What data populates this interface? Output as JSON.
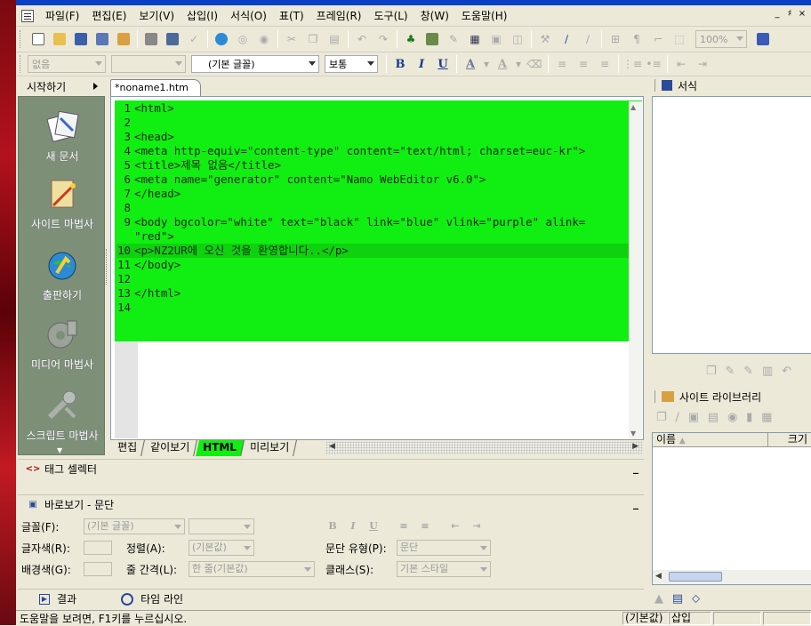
{
  "menu": {
    "items": [
      "파일(F)",
      "편집(E)",
      "보기(V)",
      "삽입(I)",
      "서식(O)",
      "표(T)",
      "프레임(R)",
      "도구(L)",
      "창(W)",
      "도움말(H)"
    ],
    "window_controls": [
      "_",
      "♯",
      "×"
    ]
  },
  "toolbar": {
    "zoom": "100%",
    "style_combo": "없음",
    "font_combo": "(기본 글꼴)",
    "size_combo": "보통",
    "bold": "B",
    "italic": "I",
    "underline": "U",
    "font_color": "A",
    "highlight": "A"
  },
  "left_panel": {
    "header": "시작하기",
    "items": [
      {
        "label": "새 문서",
        "icon": "new-document-icon"
      },
      {
        "label": "사이트 마법사",
        "icon": "site-wizard-icon"
      },
      {
        "label": "출판하기",
        "icon": "publish-globe-icon"
      },
      {
        "label": "미디어 마법사",
        "icon": "media-wizard-icon"
      },
      {
        "label": "스크립트 마법사",
        "icon": "script-wizard-icon"
      }
    ]
  },
  "document": {
    "tab": "*noname1.htm",
    "code_lines": [
      {
        "n": "1",
        "text": "<html>"
      },
      {
        "n": "2",
        "text": ""
      },
      {
        "n": "3",
        "text": "<head>"
      },
      {
        "n": "4",
        "text": "<meta http-equiv=\"content-type\" content=\"text/html; charset=euc-kr\">"
      },
      {
        "n": "5",
        "text": "<title>제목 없음</title>"
      },
      {
        "n": "6",
        "text": "<meta name=\"generator\" content=\"Namo WebEditor v6.0\">"
      },
      {
        "n": "7",
        "text": "</head>"
      },
      {
        "n": "8",
        "text": ""
      },
      {
        "n": "9",
        "text": "<body bgcolor=\"white\" text=\"black\" link=\"blue\" vlink=\"purple\" alink="
      },
      {
        "n": "",
        "text": "\"red\">"
      },
      {
        "n": "10",
        "text": "<p>NZ2UR에 오신 것을 환영합니다..</p>"
      },
      {
        "n": "11",
        "text": "</body>"
      },
      {
        "n": "12",
        "text": ""
      },
      {
        "n": "13",
        "text": "</html>"
      },
      {
        "n": "14",
        "text": ""
      }
    ],
    "current_line": "10",
    "highlight_color": "#11ee11",
    "view_tabs": [
      "편집",
      "같이보기",
      "HTML",
      "미리보기"
    ],
    "active_view": "HTML"
  },
  "tag_selector": {
    "title": "태그 셀렉터",
    "minimize": "_"
  },
  "properties": {
    "title": "바로보기 - 문단",
    "minimize": "_",
    "font_label": "글꼴(F):",
    "font_value": "(기본 글꼴)",
    "text_color_label": "글자색(R):",
    "align_label": "정렬(A):",
    "align_value": "(기본값)",
    "paragraph_type_label": "문단 유형(P):",
    "paragraph_type_value": "문단",
    "bg_color_label": "배경색(G):",
    "line_spacing_label": "줄 간격(L):",
    "line_spacing_value": "한 줄(기본값)",
    "class_label": "클래스(S):",
    "class_value": "기본 스타일",
    "bold": "B",
    "italic": "I",
    "underline": "U"
  },
  "bottom_tabs": [
    {
      "label": "결과",
      "icon": "result-play-icon"
    },
    {
      "label": "타임 라인",
      "icon": "timeline-clock-icon"
    }
  ],
  "right_panel": {
    "format_title": "서식",
    "library_title": "사이트 라이브러리",
    "columns": [
      "이름",
      "크기"
    ]
  },
  "status": {
    "help": "도움말을 보려면, F1키를 누르십시오.",
    "mode": "(기본값)",
    "insert": "삽입"
  }
}
